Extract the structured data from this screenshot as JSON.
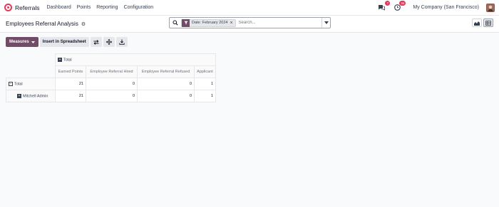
{
  "navbar": {
    "app_name": "Referrals",
    "menu": [
      "Dashboard",
      "Points",
      "Reporting",
      "Configuration"
    ],
    "messages_badge": "7",
    "activities_badge": "34",
    "company": "My Company (San Francisco)"
  },
  "control": {
    "title": "Employees Referral Analysis",
    "facet_label": "Date: February 2024",
    "search_placeholder": "Search..."
  },
  "toolbar": {
    "measures_label": "Measures",
    "insert_label": "Insert in Spreadsheet"
  },
  "pivot": {
    "group_header": "Total",
    "columns": [
      "Earned Points",
      "Employee Referral Hired",
      "Employee Referral Refused",
      "Applicant"
    ],
    "rows": [
      {
        "label": "Total",
        "values": [
          "21",
          "0",
          "0",
          "1"
        ]
      },
      {
        "label": "Mitchell Admin",
        "values": [
          "21",
          "0",
          "0",
          "1"
        ]
      }
    ]
  },
  "colors": {
    "brand": "#714b67",
    "badge": "#e03a5a"
  }
}
